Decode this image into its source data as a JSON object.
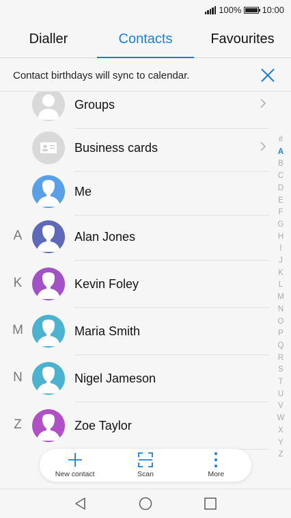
{
  "status": {
    "battery": "100%",
    "time": "10:00"
  },
  "tabs": [
    {
      "label": "Dialler"
    },
    {
      "label": "Contacts"
    },
    {
      "label": "Favourites"
    }
  ],
  "banner": {
    "text": "Contact birthdays will sync to calendar.",
    "close_icon": "close-icon"
  },
  "groups": [
    {
      "label": "Groups",
      "icon": "groups-avatar"
    },
    {
      "label": "Business cards",
      "icon": "business-card-icon"
    }
  ],
  "me": {
    "label": "Me"
  },
  "contacts": [
    {
      "letter": "A",
      "name": "Alan Jones",
      "color": "#5e6ab8"
    },
    {
      "letter": "K",
      "name": "Kevin Foley",
      "color": "#a352c5"
    },
    {
      "letter": "M",
      "name": "Maria Smith",
      "color": "#4bb3cf"
    },
    {
      "letter": "N",
      "name": "Nigel Jameson",
      "color": "#4bb3cf"
    },
    {
      "letter": "Z",
      "name": "Zoe Taylor",
      "color": "#b14fc4"
    }
  ],
  "index_letters": [
    "#",
    "A",
    "B",
    "C",
    "D",
    "E",
    "F",
    "G",
    "H",
    "I",
    "J",
    "K",
    "L",
    "M",
    "N",
    "O",
    "P",
    "Q",
    "R",
    "S",
    "T",
    "U",
    "V",
    "W",
    "X",
    "Y",
    "Z"
  ],
  "index_active": "A",
  "actions": [
    {
      "label": "New contact",
      "icon": "plus-icon"
    },
    {
      "label": "Scan",
      "icon": "scan-icon"
    },
    {
      "label": "More",
      "icon": "more-icon"
    }
  ],
  "colors": {
    "accent": "#1a7fdb",
    "me_avatar": "#5aa0e6"
  }
}
